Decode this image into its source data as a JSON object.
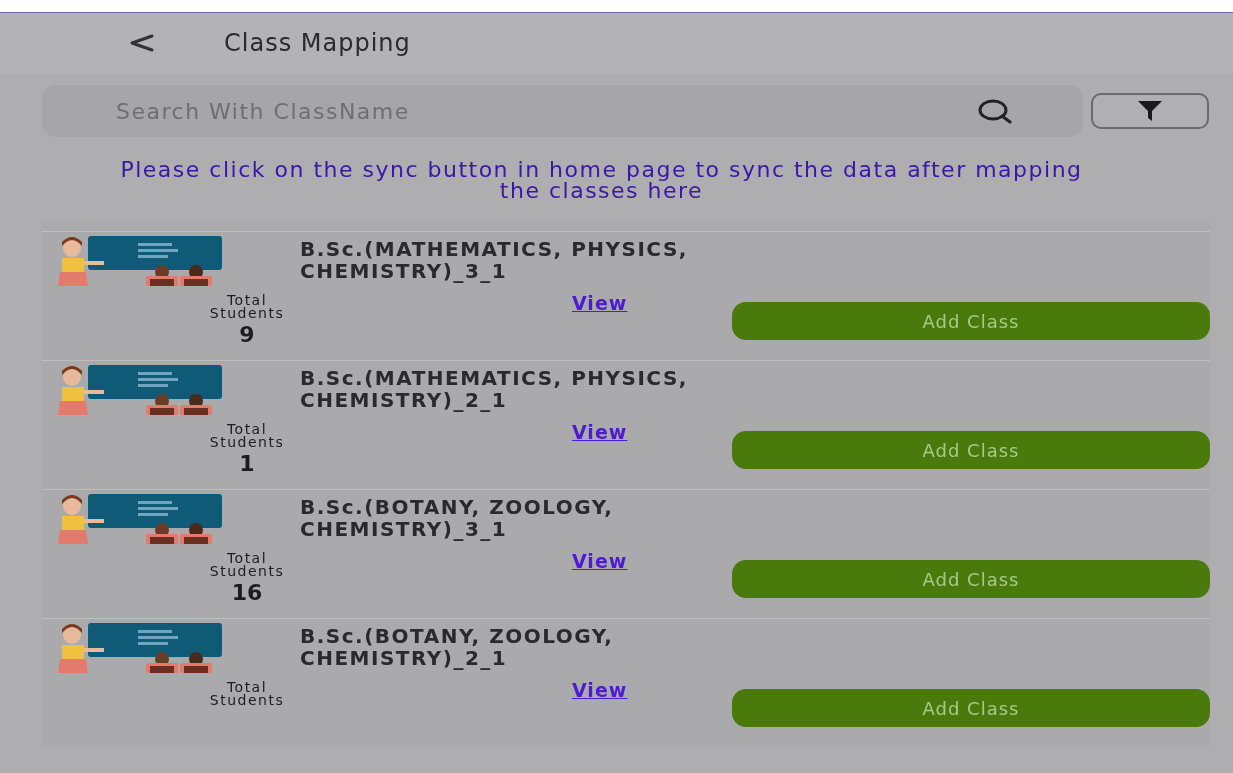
{
  "header": {
    "title": "Class Mapping"
  },
  "search": {
    "placeholder": "Search With ClassName"
  },
  "notice": "Please click on the sync button in home page to sync the data after mapping the classes here",
  "classes": [
    {
      "name": "B.Sc.(MATHEMATICS, PHYSICS, CHEMISTRY)_3_1",
      "count_label": "Total Students",
      "count": "9",
      "link": "View",
      "button": "Add Class"
    },
    {
      "name": "B.Sc.(MATHEMATICS, PHYSICS, CHEMISTRY)_2_1",
      "count_label": "Total Students",
      "count": "1",
      "link": "View",
      "button": "Add Class"
    },
    {
      "name": "B.Sc.(BOTANY, ZOOLOGY, CHEMISTRY)_3_1",
      "count_label": "Total Students",
      "count": "16",
      "link": "View",
      "button": "Add Class"
    },
    {
      "name": "B.Sc.(BOTANY, ZOOLOGY, CHEMISTRY)_2_1",
      "count_label": "Total Students",
      "link": "View",
      "button": "Add Class"
    }
  ]
}
